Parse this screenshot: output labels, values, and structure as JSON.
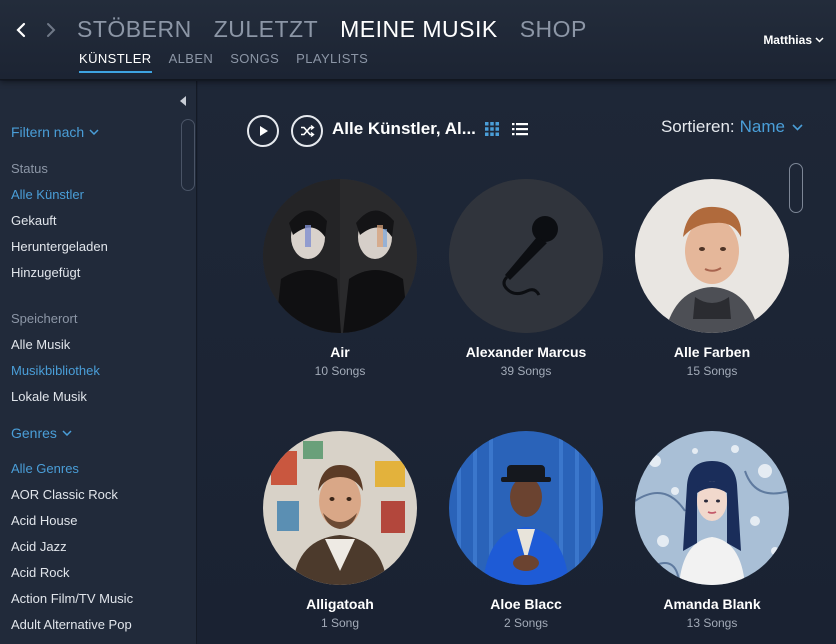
{
  "header": {
    "main_tabs": [
      {
        "label": "STÖBERN"
      },
      {
        "label": "ZULETZT"
      },
      {
        "label": "MEINE MUSIK"
      },
      {
        "label": "SHOP"
      }
    ],
    "active_main_tab": "MEINE MUSIK",
    "sub_tabs": [
      {
        "label": "KÜNSTLER"
      },
      {
        "label": "ALBEN"
      },
      {
        "label": "SONGS"
      },
      {
        "label": "PLAYLISTS"
      }
    ],
    "active_sub_tab": "KÜNSTLER",
    "user_name": "Matthias",
    "icons": {
      "back": "chevron-left-icon",
      "forward": "chevron-right-icon",
      "user_menu": "chevron-down-icon"
    }
  },
  "sidebar": {
    "filter_title": "Filtern nach",
    "status": {
      "heading": "Status",
      "items": [
        {
          "label": "Alle Künstler",
          "active": true
        },
        {
          "label": "Gekauft"
        },
        {
          "label": "Heruntergeladen"
        },
        {
          "label": "Hinzugefügt"
        }
      ]
    },
    "location": {
      "heading": "Speicherort",
      "items": [
        {
          "label": "Alle Musik"
        },
        {
          "label": "Musikbibliothek",
          "active": true
        },
        {
          "label": "Lokale Musik"
        }
      ]
    },
    "genres": {
      "title": "Genres",
      "items": [
        {
          "label": "Alle Genres",
          "active": true
        },
        {
          "label": "AOR Classic Rock"
        },
        {
          "label": "Acid House"
        },
        {
          "label": "Acid Jazz"
        },
        {
          "label": "Acid Rock"
        },
        {
          "label": "Action Film/TV Music"
        },
        {
          "label": "Adult Alternative Pop"
        }
      ]
    }
  },
  "toolbar": {
    "view_title": "Alle Künstler, Al...",
    "sort_label": "Sortieren:",
    "sort_value": "Name",
    "icons": {
      "play": "play-icon",
      "shuffle": "shuffle-icon",
      "grid_view": "grid-view-icon",
      "list_view": "list-view-icon"
    }
  },
  "artists": [
    {
      "name": "Air",
      "count": "10 Songs",
      "art": "air-duo-photo"
    },
    {
      "name": "Alexander Marcus",
      "count": "39 Songs",
      "art": "microphone-placeholder-icon"
    },
    {
      "name": "Alle Farben",
      "count": "15 Songs",
      "art": "alle-farben-photo"
    },
    {
      "name": "Alligatoah",
      "count": "1 Song",
      "art": "alligatoah-photo"
    },
    {
      "name": "Aloe Blacc",
      "count": "2 Songs",
      "art": "aloe-blacc-photo"
    },
    {
      "name": "Amanda Blank",
      "count": "13 Songs",
      "art": "amanda-blank-photo"
    }
  ],
  "colors": {
    "accent": "#4a9ed8",
    "background": "#1a2232",
    "sidebar": "#212a3a",
    "topbar": "#232c3b",
    "active_underline": "#3ea3e0"
  }
}
